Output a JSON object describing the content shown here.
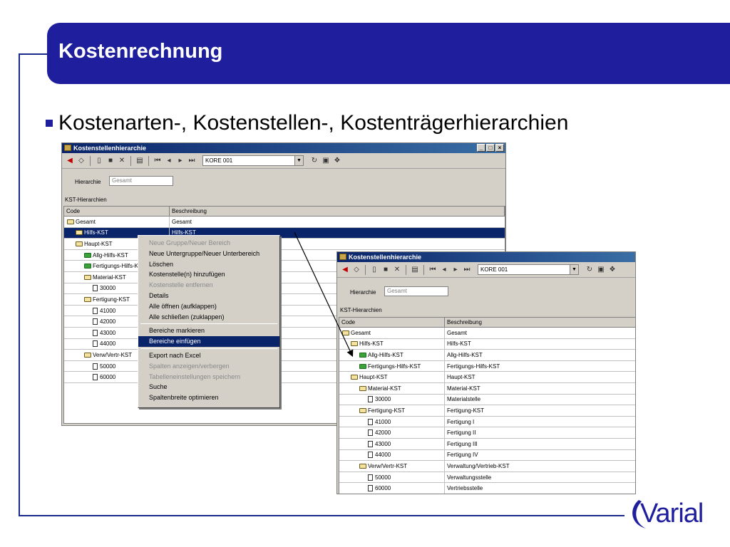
{
  "slide": {
    "title": "Kostenrechnung",
    "bullet": "Kostenarten-, Kostenstellen-, Kostenträgerhierarchien",
    "logo": "Varial"
  },
  "win1": {
    "title": "Kostenstellenhierarchie",
    "combo_value": "KORE 001",
    "hierarchy_label": "Hierarchie",
    "hierarchy_value": "Gesamt",
    "section_label": "KST-Hierarchien",
    "col_code": "Code",
    "col_desc": "Beschreibung",
    "rows": [
      {
        "code": "Gesamt",
        "desc": "Gesamt"
      },
      {
        "code": "Hilfs-KST",
        "desc": "Hilfs-KST"
      },
      {
        "code": "Haupt-KST",
        "desc": ""
      },
      {
        "code": "Allg-Hilfs-KST",
        "desc": ""
      },
      {
        "code": "Fertigungs-Hilfs-KS",
        "desc": ""
      },
      {
        "code": "Material-KST",
        "desc": ""
      },
      {
        "code": "30000",
        "desc": ""
      },
      {
        "code": "Fertigung-KST",
        "desc": ""
      },
      {
        "code": "41000",
        "desc": ""
      },
      {
        "code": "42000",
        "desc": ""
      },
      {
        "code": "43000",
        "desc": ""
      },
      {
        "code": "44000",
        "desc": ""
      },
      {
        "code": "Verw/Vertr-KST",
        "desc": ""
      },
      {
        "code": "50000",
        "desc": ""
      },
      {
        "code": "60000",
        "desc": ""
      }
    ]
  },
  "context_menu": {
    "items": [
      "Neue Gruppe/Neuer Bereich",
      "Neue Untergruppe/Neuer Unterbereich",
      "Löschen",
      "Kostenstelle(n) hinzufügen",
      "Kostenstelle entfernen",
      "Details",
      "Alle öffnen (aufklappen)",
      "Alle schließen (zuklappen)",
      "Bereiche markieren",
      "Bereiche einfügen",
      "Export nach Excel",
      "Spalten anzeigen/verbergen",
      "Tabelleneinstellungen speichern",
      "Suche",
      "Spaltenbreite optimieren"
    ]
  },
  "win2": {
    "title": "Kostenstellenhierarchie",
    "combo_value": "KORE 001",
    "hierarchy_label": "Hierarchie",
    "hierarchy_value": "Gesamt",
    "section_label": "KST-Hierarchien",
    "col_code": "Code",
    "col_desc": "Beschreibung",
    "rows": [
      {
        "code": "Gesamt",
        "desc": "Gesamt"
      },
      {
        "code": "Hilfs-KST",
        "desc": "Hilfs-KST"
      },
      {
        "code": "Allg-Hilfs-KST",
        "desc": "Allg-Hilfs-KST"
      },
      {
        "code": "Fertigungs-Hilfs-KST",
        "desc": "Fertigungs-Hilfs-KST"
      },
      {
        "code": "Haupt-KST",
        "desc": "Haupt-KST"
      },
      {
        "code": "Material-KST",
        "desc": "Material-KST"
      },
      {
        "code": "30000",
        "desc": "Materialstelle"
      },
      {
        "code": "Fertigung-KST",
        "desc": "Fertigung-KST"
      },
      {
        "code": "41000",
        "desc": "Fertigung I"
      },
      {
        "code": "42000",
        "desc": "Fertigung II"
      },
      {
        "code": "43000",
        "desc": "Fertigung III"
      },
      {
        "code": "44000",
        "desc": "Fertigung IV"
      },
      {
        "code": "Verw/Vertr-KST",
        "desc": "Verwaltung/Vertrieb-KST"
      },
      {
        "code": "50000",
        "desc": "Verwaltungsstelle"
      },
      {
        "code": "60000",
        "desc": "Vertriebsstelle"
      }
    ]
  },
  "colors": {
    "brand": "#1f1f9e",
    "selection": "#0a246a"
  }
}
